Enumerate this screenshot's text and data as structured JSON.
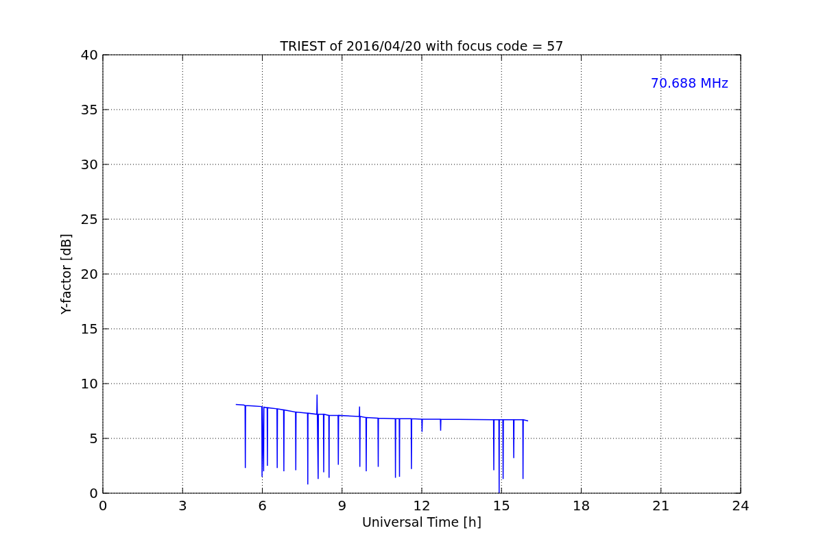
{
  "chart_data": {
    "type": "line",
    "title": "TRIEST of 2016/04/20 with focus code = 57",
    "xlabel": "Universal Time [h]",
    "ylabel": "Y-factor [dB]",
    "x": [
      5.0,
      5.3,
      5.35,
      5.36,
      5.37,
      5.7,
      5.98,
      5.99,
      6.0,
      6.05,
      6.06,
      6.18,
      6.19,
      6.2,
      6.55,
      6.56,
      6.57,
      6.8,
      6.81,
      6.82,
      7.25,
      7.26,
      7.27,
      7.7,
      7.71,
      7.72,
      8.05,
      8.06,
      8.07,
      8.1,
      8.11,
      8.3,
      8.31,
      8.32,
      8.5,
      8.51,
      8.52,
      8.85,
      8.86,
      8.87,
      9.65,
      9.66,
      9.67,
      9.68,
      9.9,
      9.91,
      9.92,
      10.35,
      10.36,
      10.37,
      11.0,
      11.01,
      11.02,
      11.15,
      11.16,
      11.17,
      11.6,
      11.61,
      11.62,
      12.0,
      12.01,
      12.02,
      12.7,
      12.71,
      12.72,
      14.7,
      14.71,
      14.72,
      14.9,
      14.91,
      14.92,
      15.05,
      15.06,
      15.07,
      15.45,
      15.46,
      15.47,
      15.8,
      15.81,
      15.82,
      16.0
    ],
    "series": [
      {
        "name": "70.688 MHz",
        "color": "#0000ff",
        "values": [
          8.1,
          8.05,
          8.0,
          2.3,
          8.0,
          7.95,
          7.9,
          1.5,
          7.9,
          2.0,
          7.85,
          7.8,
          2.5,
          7.8,
          7.7,
          2.3,
          7.7,
          7.6,
          2.0,
          7.6,
          7.4,
          2.1,
          7.4,
          7.3,
          0.8,
          7.3,
          7.2,
          9.0,
          7.2,
          1.3,
          7.2,
          7.2,
          1.9,
          7.2,
          7.1,
          1.4,
          7.1,
          7.1,
          2.6,
          7.1,
          7.0,
          7.9,
          2.4,
          7.0,
          6.9,
          2.0,
          6.9,
          6.85,
          2.4,
          6.85,
          6.8,
          1.4,
          6.8,
          6.8,
          1.5,
          6.8,
          6.8,
          2.2,
          6.8,
          6.75,
          5.6,
          6.75,
          6.75,
          5.7,
          6.75,
          6.7,
          2.1,
          6.7,
          6.7,
          0.0,
          6.7,
          6.7,
          1.3,
          6.7,
          6.7,
          3.2,
          6.7,
          6.7,
          1.3,
          6.7,
          6.6
        ]
      }
    ],
    "grid": true,
    "xlim": [
      0,
      24
    ],
    "ylim": [
      0,
      40
    ],
    "xticks": [
      0,
      3,
      6,
      9,
      12,
      15,
      18,
      21,
      24
    ],
    "yticks": [
      0,
      5,
      10,
      15,
      20,
      25,
      30,
      35,
      40
    ]
  }
}
